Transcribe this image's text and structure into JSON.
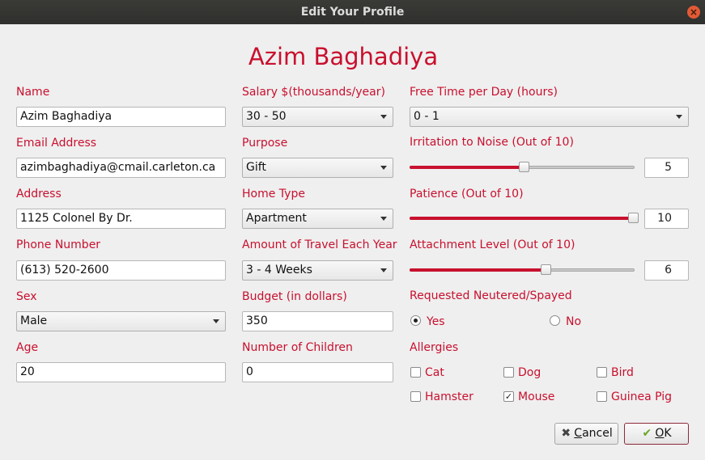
{
  "window": {
    "title": "Edit Your Profile",
    "close_symbol": "×"
  },
  "heading": "Azim Baghadiya",
  "col1": {
    "name_label": "Name",
    "name_value": "Azim Baghadiya",
    "email_label": "Email Address",
    "email_value": "azimbaghadiya@cmail.carleton.ca",
    "address_label": "Address",
    "address_value": "1125 Colonel By Dr.",
    "phone_label": "Phone Number",
    "phone_value": "(613) 520-2600",
    "sex_label": "Sex",
    "sex_value": "Male",
    "age_label": "Age",
    "age_value": "20"
  },
  "col2": {
    "salary_label": "Salary $(thousands/year)",
    "salary_value": "30 - 50",
    "purpose_label": "Purpose",
    "purpose_value": "Gift",
    "home_label": "Home Type",
    "home_value": "Apartment",
    "travel_label": "Amount of Travel Each Year",
    "travel_value": "3 - 4 Weeks",
    "budget_label": "Budget (in dollars)",
    "budget_value": "350",
    "children_label": "Number of Children",
    "children_value": "0"
  },
  "col3": {
    "freetime_label": "Free Time per Day (hours)",
    "freetime_value": "0 - 1",
    "noise_label": "Irritation to Noise (Out of 10)",
    "noise_value": "5",
    "patience_label": "Patience (Out of 10)",
    "patience_value": "10",
    "attachment_label": "Attachment Level (Out of 10)",
    "attachment_value": "6",
    "neutered_label": "Requested Neutered/Spayed",
    "neutered_yes": "Yes",
    "neutered_no": "No",
    "allergies_label": "Allergies",
    "allergies": [
      {
        "label": "Cat",
        "checked": false
      },
      {
        "label": "Dog",
        "checked": false
      },
      {
        "label": "Bird",
        "checked": false
      },
      {
        "label": "Hamster",
        "checked": false
      },
      {
        "label": "Mouse",
        "checked": true
      },
      {
        "label": "Guinea Pig",
        "checked": false
      }
    ],
    "check_symbol": "✓"
  },
  "buttons": {
    "cancel_label": "ancel",
    "cancel_mnemonic": "C",
    "cancel_icon": "✖",
    "ok_label": "K",
    "ok_mnemonic": "O",
    "ok_icon": "✔"
  },
  "colors": {
    "accent": "#c8102e",
    "titlebar": "#353533",
    "background": "#efefef"
  }
}
